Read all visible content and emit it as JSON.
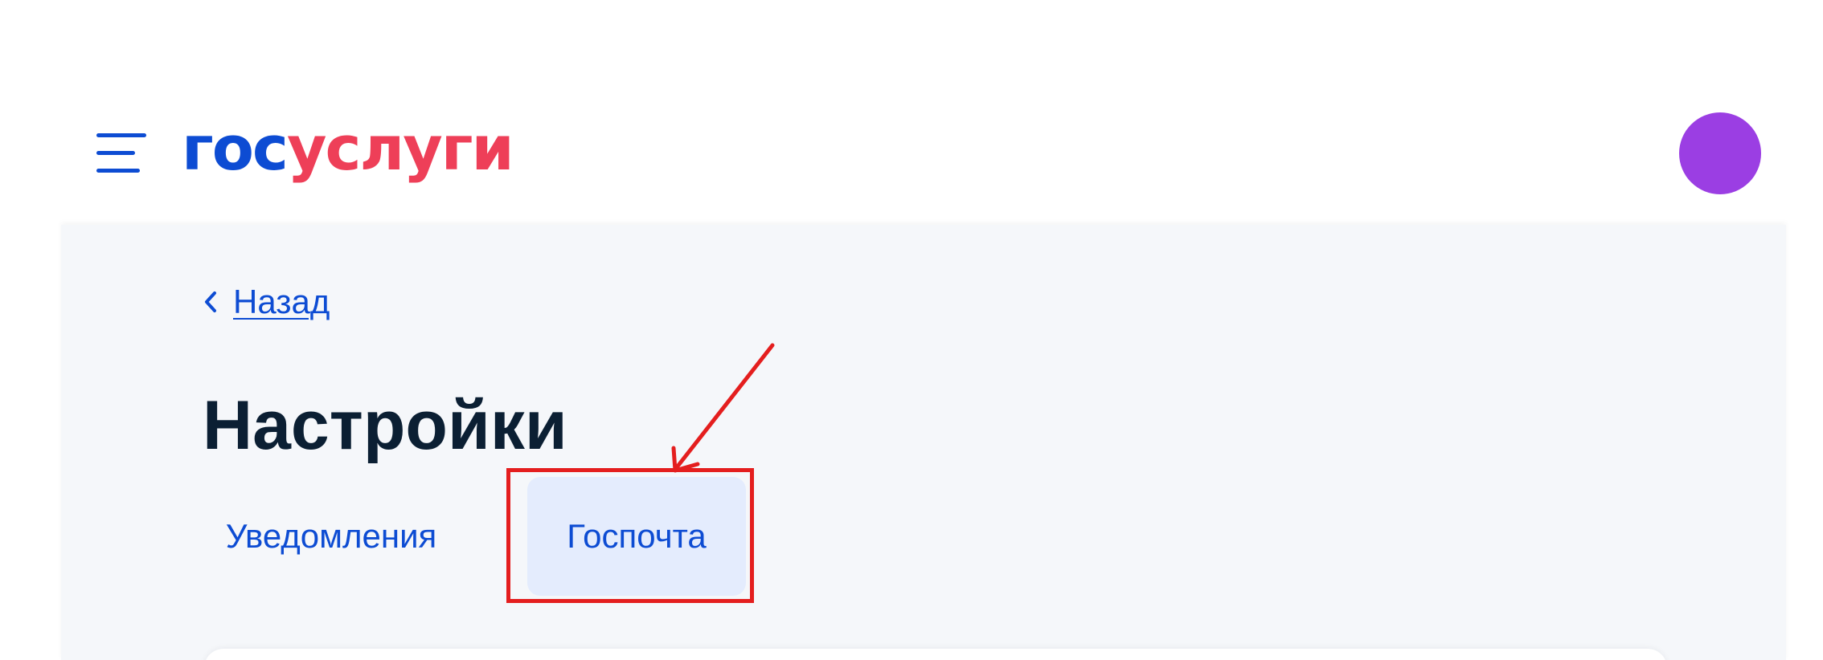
{
  "header": {
    "menu_icon": "hamburger-menu-icon",
    "logo": {
      "part1": "гос",
      "part2": "услуги",
      "color_primary": "#0d4cd3",
      "color_accent": "#ee3f58"
    },
    "avatar_color": "#9b3ee3"
  },
  "main": {
    "back_label": "Назад",
    "back_icon": "chevron-left-icon",
    "title": "Настройки",
    "tabs": [
      {
        "label": "Уведомления",
        "active": false
      },
      {
        "label": "Госпочта",
        "active": true
      }
    ]
  },
  "annotation": {
    "highlight_color": "#e41e1e",
    "target": "Госпочта"
  }
}
